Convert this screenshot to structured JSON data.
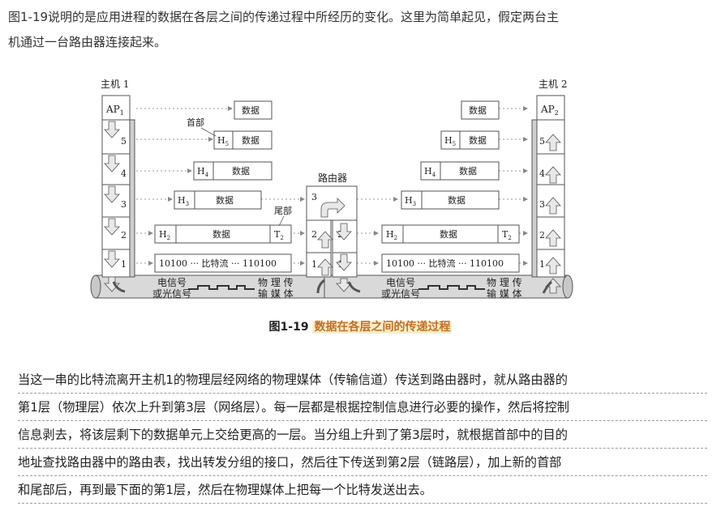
{
  "intro": {
    "line1": "图1-19说明的是应用进程的数据在各层之间的传递过程中所经历的变化。这里为简单起见，假定两台主",
    "line2": "机通过一台路由器连接起来。"
  },
  "figure": {
    "host1": "主机 1",
    "host2": "主机 2",
    "router": "路由器",
    "header_note": "首部",
    "trailer_note": "尾部",
    "ap1": "AP",
    "ap1_sub": "1",
    "ap2": "AP",
    "ap2_sub": "2",
    "layers": [
      "5",
      "4",
      "3",
      "2",
      "1"
    ],
    "router_layers": [
      "3",
      "2",
      "1"
    ],
    "data": "数据",
    "h5": "H",
    "h5_sub": "5",
    "h4": "H",
    "h4_sub": "4",
    "h3": "H",
    "h3_sub": "3",
    "h2": "H",
    "h2_sub": "2",
    "t2": "T",
    "t2_sub": "2",
    "bitstream": "10100 ··· 比特流 ··· 110100",
    "signal_1": "电信号",
    "signal_2": "或光信号",
    "medium_1": "物 理 传",
    "medium_2": "输 媒 体"
  },
  "caption": {
    "label": "图1-19",
    "title": "数据在各层之间的传递过程"
  },
  "body": {
    "lines": [
      "当这一串的比特流离开主机1的物理层经网络的物理媒体（传输信道）传送到路由器时，就从路由器的",
      "第1层（物理层）依次上升到第3层（网络层）。每一层都是根据控制信息进行必要的操作，然后将控制",
      "信息剥去，将该层剩下的数据单元上交给更高的一层。当分组上升到了第3层时，就根据首部中的目的",
      "地址查找路由器中的路由表，找出转发分组的接口，然后往下传送到第2层（链路层），加上新的首部",
      "和尾部后，再到最下面的第1层，然后在物理媒体上把每一个比特发送出去。"
    ]
  }
}
